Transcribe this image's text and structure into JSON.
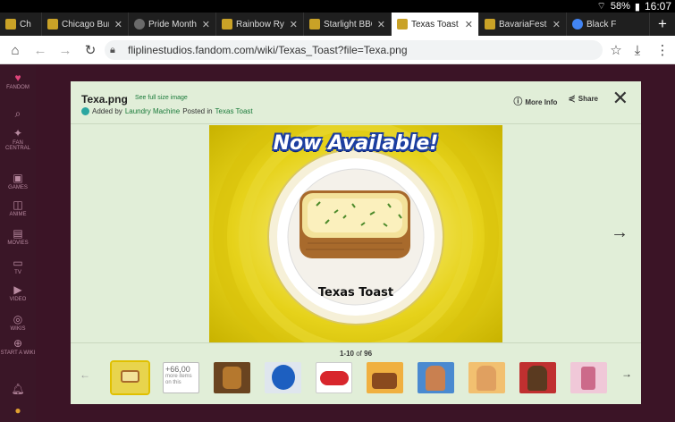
{
  "status": {
    "battery": "58%",
    "time": "16:07"
  },
  "tabs": [
    {
      "title": "Ch",
      "favicon": "#c9a227"
    },
    {
      "title": "Chicago Bun |",
      "favicon": "#c9a227"
    },
    {
      "title": "Pride Month |",
      "favicon": "#6a6a6a"
    },
    {
      "title": "Rainbow Rye E",
      "favicon": "#c9a227"
    },
    {
      "title": "Starlight BBQ |",
      "favicon": "#c9a227"
    },
    {
      "title": "Texas Toast |",
      "favicon": "#c9a227",
      "active": true
    },
    {
      "title": "BavariaFest |",
      "favicon": "#c9a227"
    },
    {
      "title": "Black F",
      "favicon": "#4285f4"
    }
  ],
  "url": "fliplinestudios.fandom.com/wiki/Texas_Toast?file=Texa.png",
  "rail": [
    "FANDOM",
    "FAN CENTRAL",
    "GAMES",
    "ANIME",
    "MOVIES",
    "TV",
    "VIDEO",
    "WIKIS",
    "START A WIKI"
  ],
  "modal": {
    "title": "Texa.png",
    "full_size": "See full size image",
    "added_by": "Added by",
    "user": "Laundry Machine",
    "posted_in": "Posted in",
    "article": "Texas Toast",
    "more_info": "More Info",
    "share": "Share"
  },
  "image": {
    "banner": "Now Available!",
    "caption": "Texas Toast"
  },
  "pager": {
    "range": "1-10",
    "of": "of",
    "total": "96"
  },
  "more_thumb": {
    "count": "+66,00",
    "text": "more items on this"
  },
  "thumb_colors": [
    "#e8d44d",
    "#ffffff",
    "#5a3a1a",
    "#1d5fc0",
    "#ffffff",
    "#d88c3a",
    "#c9772e",
    "#e0a050",
    "#7a3a22",
    "#cc6a8a",
    "#b87a40"
  ]
}
